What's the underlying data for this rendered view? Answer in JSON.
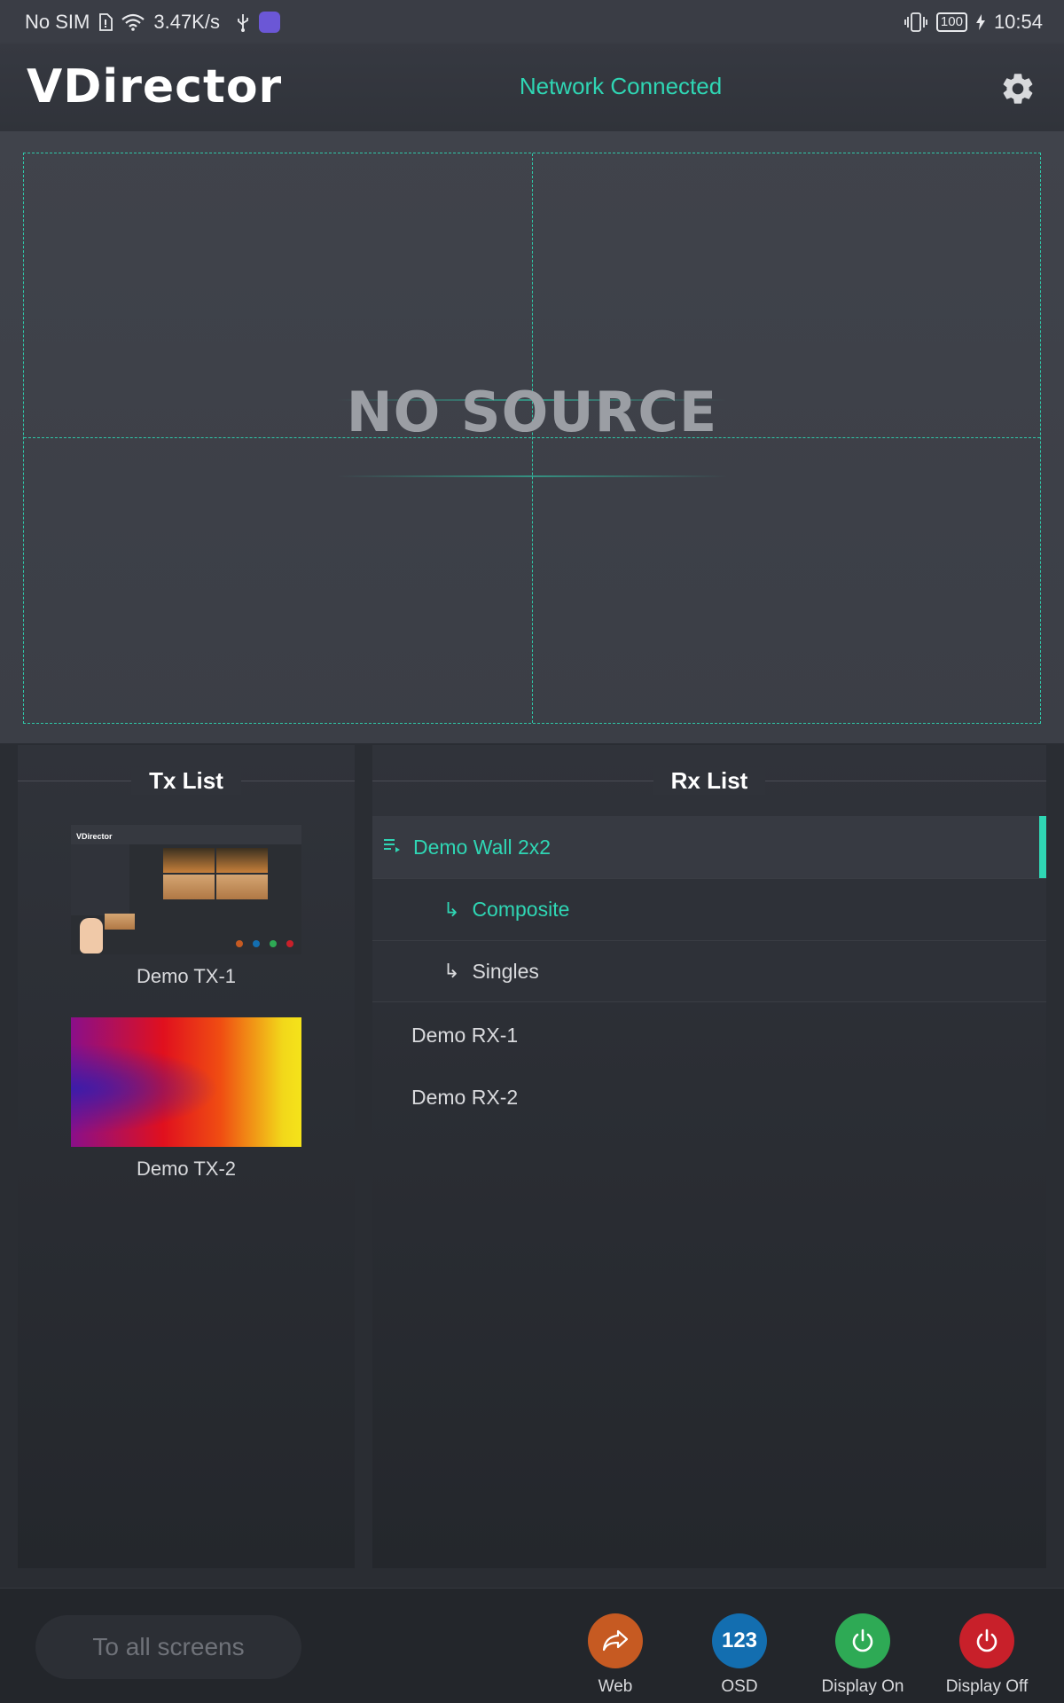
{
  "status_bar": {
    "carrier": "No SIM",
    "net_speed": "3.47K/s",
    "battery": "100",
    "time": "10:54",
    "icons": [
      "sim-icon",
      "wifi-icon",
      "usb-icon",
      "app-icon",
      "vibrate-icon",
      "battery-icon",
      "charging-icon"
    ]
  },
  "header": {
    "logo": "VDirector",
    "network_status": "Network Connected",
    "settings_icon": "gear-icon"
  },
  "preview": {
    "placeholder": "NO SOURCE",
    "grid": "2x2"
  },
  "tx_list": {
    "title": "Tx List",
    "items": [
      {
        "label": "Demo TX-1",
        "thumb": "screenshot-thumbnail"
      },
      {
        "label": "Demo TX-2",
        "thumb": "gradient-thumbnail"
      }
    ]
  },
  "rx_list": {
    "title": "Rx List",
    "wall": {
      "label": "Demo Wall 2x2",
      "icon": "playlist-icon",
      "selected": true
    },
    "sub_items": [
      {
        "label": "Composite",
        "active": true
      },
      {
        "label": "Singles",
        "active": false
      }
    ],
    "items": [
      {
        "label": "Demo RX-1"
      },
      {
        "label": "Demo RX-2"
      }
    ]
  },
  "bottom_bar": {
    "to_all": "To all screens",
    "actions": [
      {
        "label": "Web",
        "icon": "share-icon",
        "color": "#c65a22"
      },
      {
        "label": "OSD",
        "icon_text": "123",
        "color": "#136eb0"
      },
      {
        "label": "Display On",
        "icon": "power-icon",
        "color": "#2eaa55"
      },
      {
        "label": "Display Off",
        "icon": "power-icon",
        "color": "#c8202a"
      }
    ]
  },
  "colors": {
    "accent": "#2fd6b4",
    "background": "#2a2d33"
  }
}
